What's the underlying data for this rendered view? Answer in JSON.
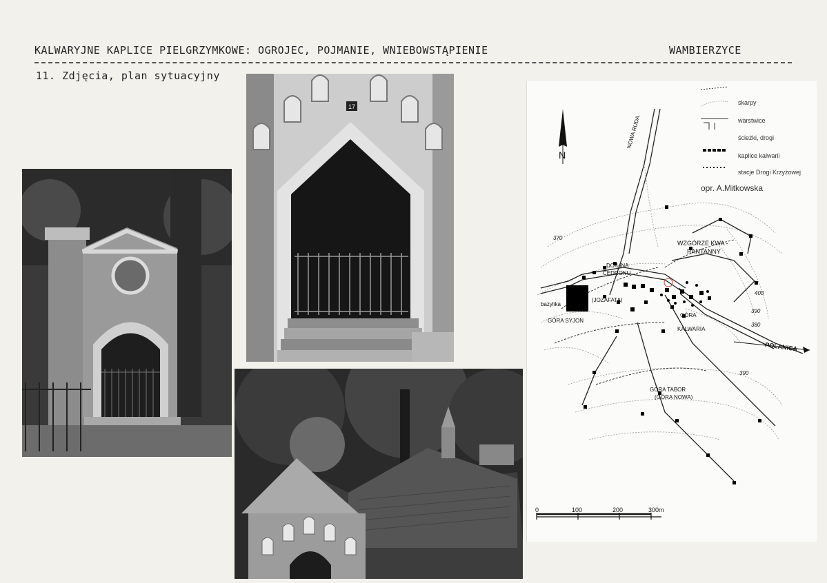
{
  "header": {
    "title": "KALWARYJNE KAPLICE PIELGRZYMKOWE: OGROJEC, POJMANIE, WNIEBOWSTĄPIENIE",
    "place": "WAMBIERZYCE",
    "section": "11. Zdjęcia, plan sytuacyjny"
  },
  "photos": {
    "chapel_number": "17"
  },
  "map": {
    "legend": [
      {
        "key": "skarpy",
        "label": "skarpy"
      },
      {
        "key": "warstwice",
        "label": "warstwice"
      },
      {
        "key": "sciezki",
        "label": "ścieżki, drogi"
      },
      {
        "key": "kaplice",
        "label": "kaplice kalwarii"
      },
      {
        "key": "stacje",
        "label": "stacje Drogi Krzyżowej"
      }
    ],
    "author": "opr. A.Mitkowska",
    "north": "N",
    "labels": {
      "nowa_ruda": "NOWA RUDA",
      "polanica": "POLANICA",
      "wzgorze1": "WZGÓRZE KWA -",
      "wzgorze2": "RANTANNY",
      "dolina1": "DO-LINA",
      "dolina2": "CEDRONU",
      "jozafata": "(JOZAFATA)",
      "bazylika": "bazylika",
      "gora_syjon": "GÓRA SYJON",
      "gora": "GÓRA",
      "kalwaria": "KALWARIA",
      "gora_tabor": "GÓRA TABOR",
      "gora_nowa": "(GÓRA NOWA)",
      "c370": "370",
      "c400": "400",
      "c390a": "390",
      "c380": "380",
      "c390b": "390"
    },
    "scale": [
      "0",
      "100",
      "200",
      "300m"
    ]
  }
}
